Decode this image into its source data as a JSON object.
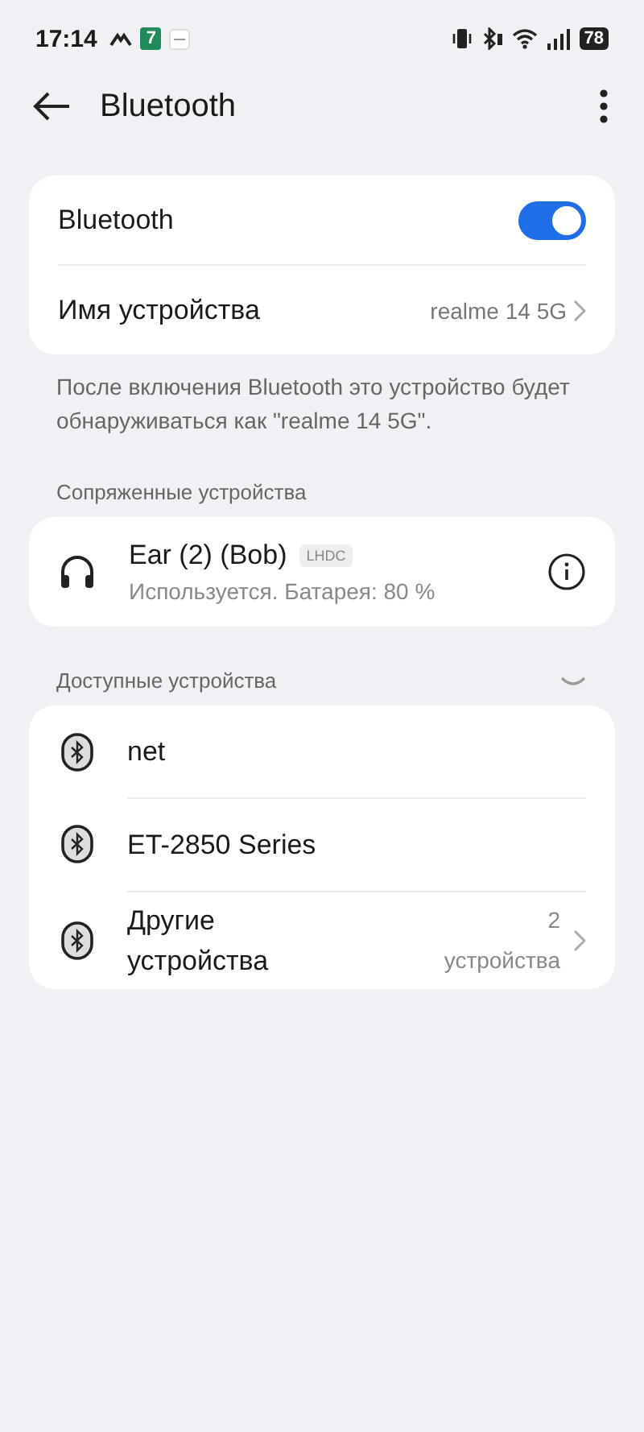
{
  "status_bar": {
    "time": "17:14",
    "app_badge": "7",
    "battery": "78"
  },
  "header": {
    "title": "Bluetooth"
  },
  "main_card": {
    "rows": [
      {
        "kind": "toggle",
        "label": "Bluetooth",
        "on": true
      },
      {
        "kind": "link",
        "label": "Имя устройства",
        "value": "realme 14 5G"
      }
    ]
  },
  "note": "После включения Bluetooth это устройство будет обнаруживаться как \"realme 14 5G\".",
  "paired": {
    "title": "Сопряженные устройства",
    "devices": [
      {
        "name": "Ear (2) (Bob)",
        "codec": "LHDC",
        "status": "Используется. Батарея: 80 %"
      }
    ]
  },
  "available": {
    "title": "Доступные устройства",
    "searching": true,
    "devices": [
      {
        "kind": "device",
        "name": "net"
      },
      {
        "kind": "device",
        "name": "ET-2850 Series"
      },
      {
        "kind": "group",
        "name": "Другие устройства",
        "value": "2 устройства"
      }
    ]
  }
}
